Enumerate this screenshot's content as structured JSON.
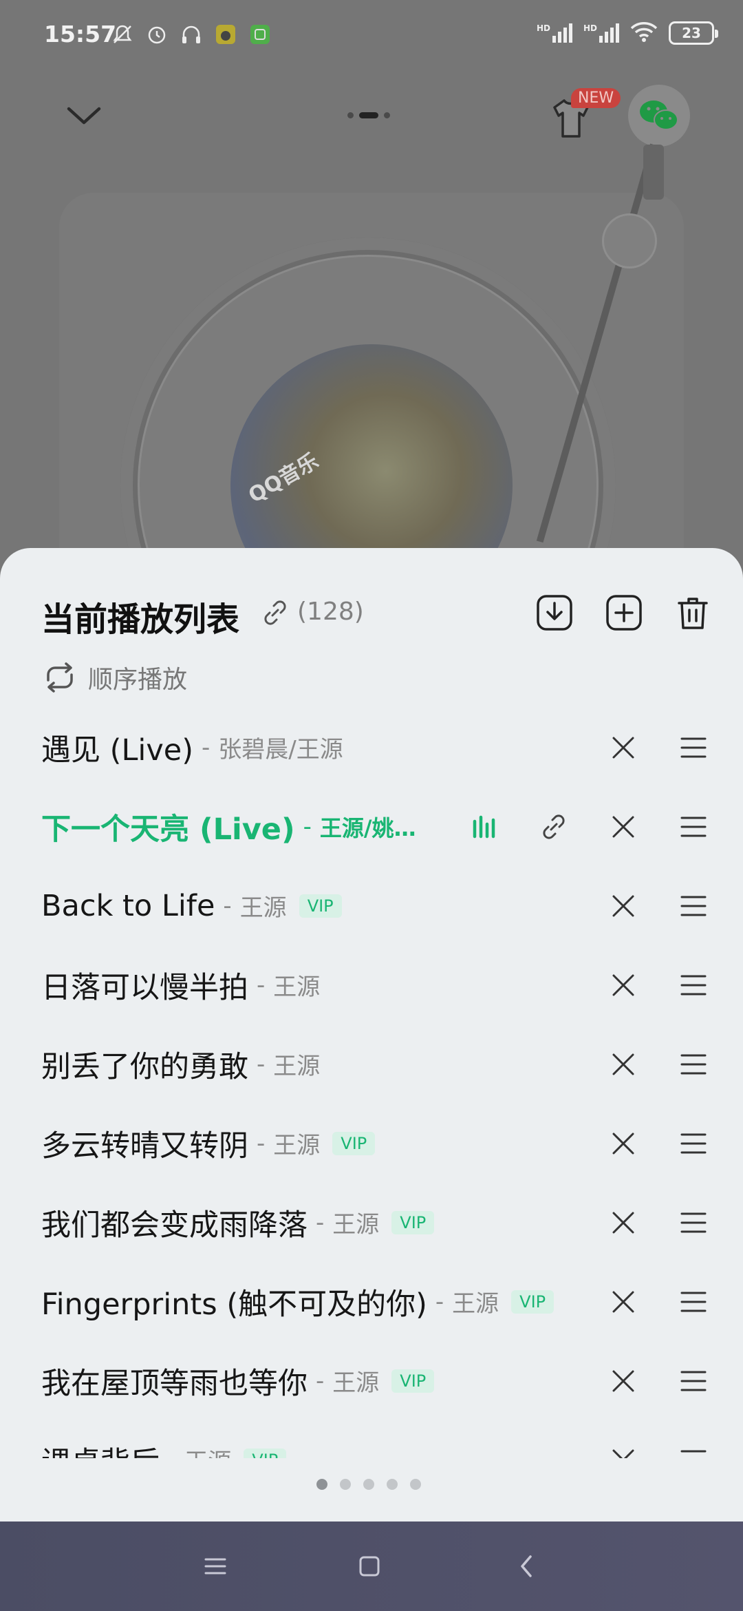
{
  "status_bar": {
    "time": "15:57",
    "battery": "23",
    "signal1": "HD",
    "signal2": "HD",
    "icons": [
      "mute-icon",
      "alarm-icon",
      "headphones-icon",
      "app-notification-icon",
      "app-notification-icon",
      "wifi-icon"
    ]
  },
  "player": {
    "new_badge": "NEW",
    "cover_text": "QQ音乐"
  },
  "playlist": {
    "title": "当前播放列表",
    "count": "(128)",
    "mode_label": "顺序播放",
    "accent_color": "#19b573",
    "songs": [
      {
        "name": "遇见 (Live)",
        "dash": "-",
        "artist": "张碧晨/王源",
        "vip": ""
      },
      {
        "name": "下一个天亮 (Live)",
        "dash": "-",
        "artist": "王源/姚…",
        "vip": ""
      },
      {
        "name": "Back to Life",
        "dash": "-",
        "artist": "王源",
        "vip": "VIP"
      },
      {
        "name": "日落可以慢半拍",
        "dash": "-",
        "artist": "王源",
        "vip": ""
      },
      {
        "name": "别丢了你的勇敢",
        "dash": "-",
        "artist": "王源",
        "vip": ""
      },
      {
        "name": "多云转晴又转阴",
        "dash": "-",
        "artist": "王源",
        "vip": "VIP"
      },
      {
        "name": "我们都会变成雨降落",
        "dash": "-",
        "artist": "王源",
        "vip": "VIP"
      },
      {
        "name": "Fingerprints (触不可及的你)",
        "dash": "-",
        "artist": "王源",
        "vip": "VIP"
      },
      {
        "name": "我在屋顶等雨也等你",
        "dash": "-",
        "artist": "王源",
        "vip": "VIP"
      },
      {
        "name": "课桌背后",
        "dash": "-",
        "artist": "王源",
        "vip": "VIP"
      }
    ]
  },
  "pager": {
    "pages": 5,
    "active": 0
  }
}
